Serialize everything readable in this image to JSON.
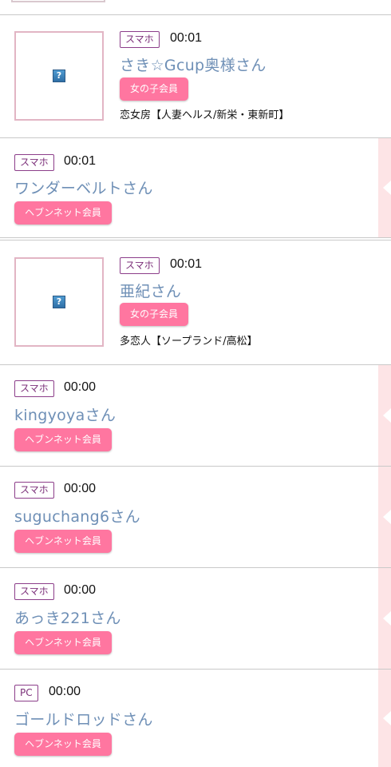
{
  "entries": [
    {
      "device": "スマホ",
      "time": "00:01",
      "name": "さき☆Gcup奥様さん",
      "member": "女の子会員",
      "shop": "恋女房【人妻ヘルス/新栄・東新町】",
      "thumb_icon": "broken-image-icon"
    },
    {
      "device": "スマホ",
      "time": "00:01",
      "name": "ワンダーベルトさん",
      "member": "ヘブンネット会員"
    },
    {
      "device": "スマホ",
      "time": "00:01",
      "name": "亜紀さん",
      "member": "女の子会員",
      "shop": "多恋人【ソープランド/高松】",
      "thumb_icon": "broken-image-icon"
    },
    {
      "device": "スマホ",
      "time": "00:00",
      "name": "kingyoyaさん",
      "member": "ヘブンネット会員"
    },
    {
      "device": "スマホ",
      "time": "00:00",
      "name": "suguchang6さん",
      "member": "ヘブンネット会員"
    },
    {
      "device": "スマホ",
      "time": "00:00",
      "name": "あっき221さん",
      "member": "ヘブンネット会員"
    },
    {
      "device": "PC",
      "time": "00:00",
      "name": "ゴールドロッドさん",
      "member": "ヘブンネット会員"
    }
  ],
  "colors": {
    "name_link": "#6e8fb6",
    "member_badge": "#ff76a0",
    "device_border": "#8c3e8a",
    "thumb_border": "#e2b5c4",
    "side_accent": "#fde4e6"
  }
}
